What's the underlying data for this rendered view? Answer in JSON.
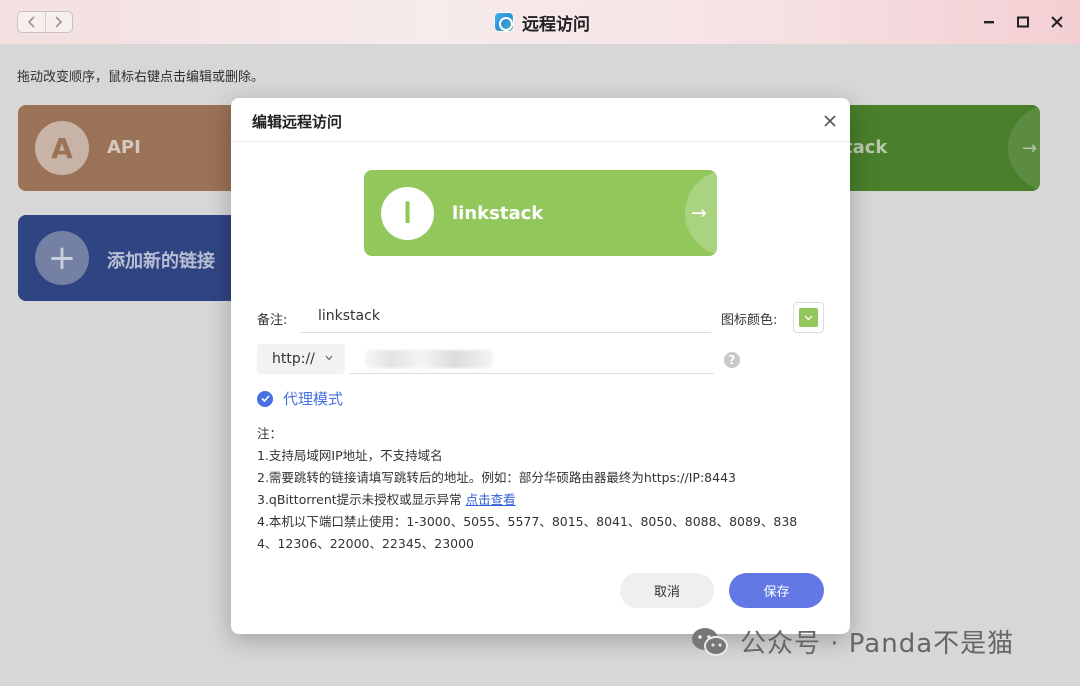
{
  "window": {
    "title": "远程访问"
  },
  "background": {
    "hint": "拖动改变顺序，鼠标右键点击编辑或删除。",
    "tiles": [
      {
        "label": "API",
        "letter": "A",
        "color": "#a87c5d"
      },
      {
        "label": "添加新的链接",
        "letter": "+",
        "color": "#344a8f"
      },
      {
        "label": "tack",
        "color": "#4f8a2e"
      }
    ]
  },
  "dialog": {
    "title": "编辑远程访问",
    "preview": {
      "letter": "l",
      "label": "linkstack",
      "arrow": "→",
      "color": "#92c75b"
    },
    "note_label": "备注:",
    "note_value": "linkstack",
    "icon_color_label": "图标颜色:",
    "icon_color": "#92c75b",
    "protocol": "http://",
    "address_partial": "192.168.x.x:8080",
    "proxy_label": "代理模式",
    "notes": {
      "title": "注：",
      "line1": "1.支持局域网IP地址，不支持域名",
      "line2": "2.需要跳转的链接请填写跳转后的地址。例如：部分华硕路由器最终为https://IP:8443",
      "line3": "3.qBittorrent提示未授权或显示异常",
      "line3_link": "点击查看",
      "line4a": "4.本机以下端口禁止使用：1-3000、5055、5577、8015、8041、8050、8088、8089、838",
      "line4b": "4、12306、22000、22345、23000"
    },
    "cancel_label": "取消",
    "save_label": "保存"
  },
  "watermark": {
    "text": "公众号 · Panda不是猫"
  }
}
